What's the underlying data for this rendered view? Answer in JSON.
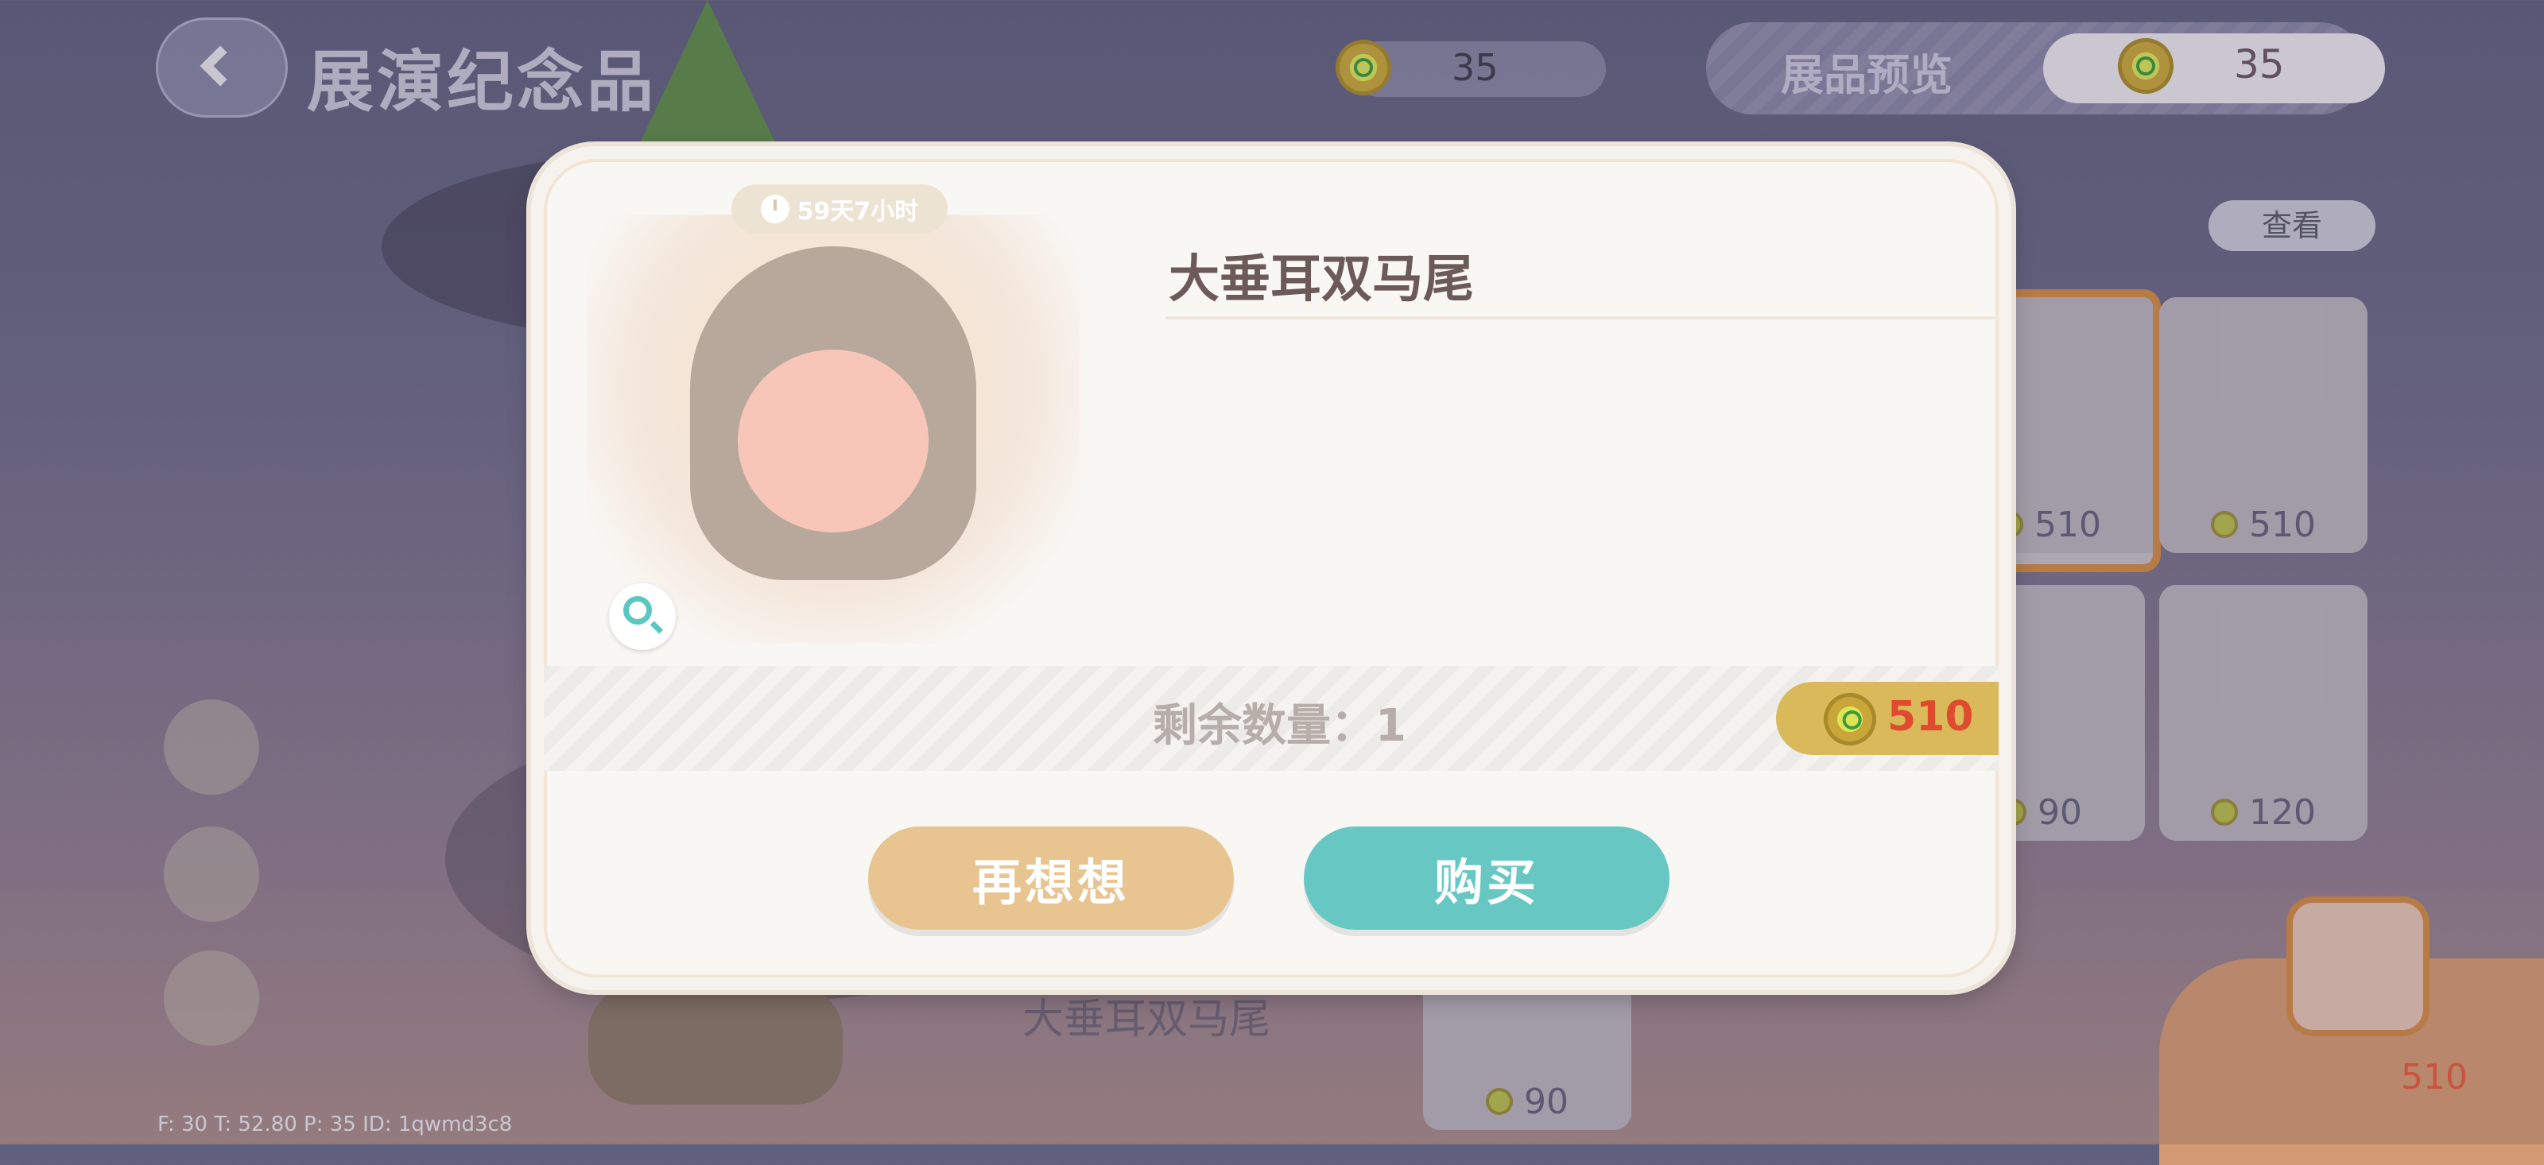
{
  "header": {
    "title": "展演纪念品",
    "currency_amount": "35",
    "preview_label": "展品预览",
    "preview_amount": "35",
    "view_button": "查看"
  },
  "grid": {
    "prices": [
      "510",
      "510",
      "90",
      "120",
      "90"
    ],
    "selected_mini_price": "510"
  },
  "modal": {
    "timer": "59天7小时",
    "item_name": "大垂耳双马尾",
    "stock_text": "剩余数量：1",
    "price": "510",
    "cancel_button": "再想想",
    "buy_button": "购买"
  },
  "footer": {
    "item_name": "大垂耳双马尾",
    "debug": "F: 30    T: 52.80    P: 35    ID: 1qwmd3c8"
  },
  "colors": {
    "buy_button": "#67c8c3",
    "cancel_button": "#e7c490",
    "price_text": "#e04a2e",
    "price_tag": "#d9b95a"
  }
}
